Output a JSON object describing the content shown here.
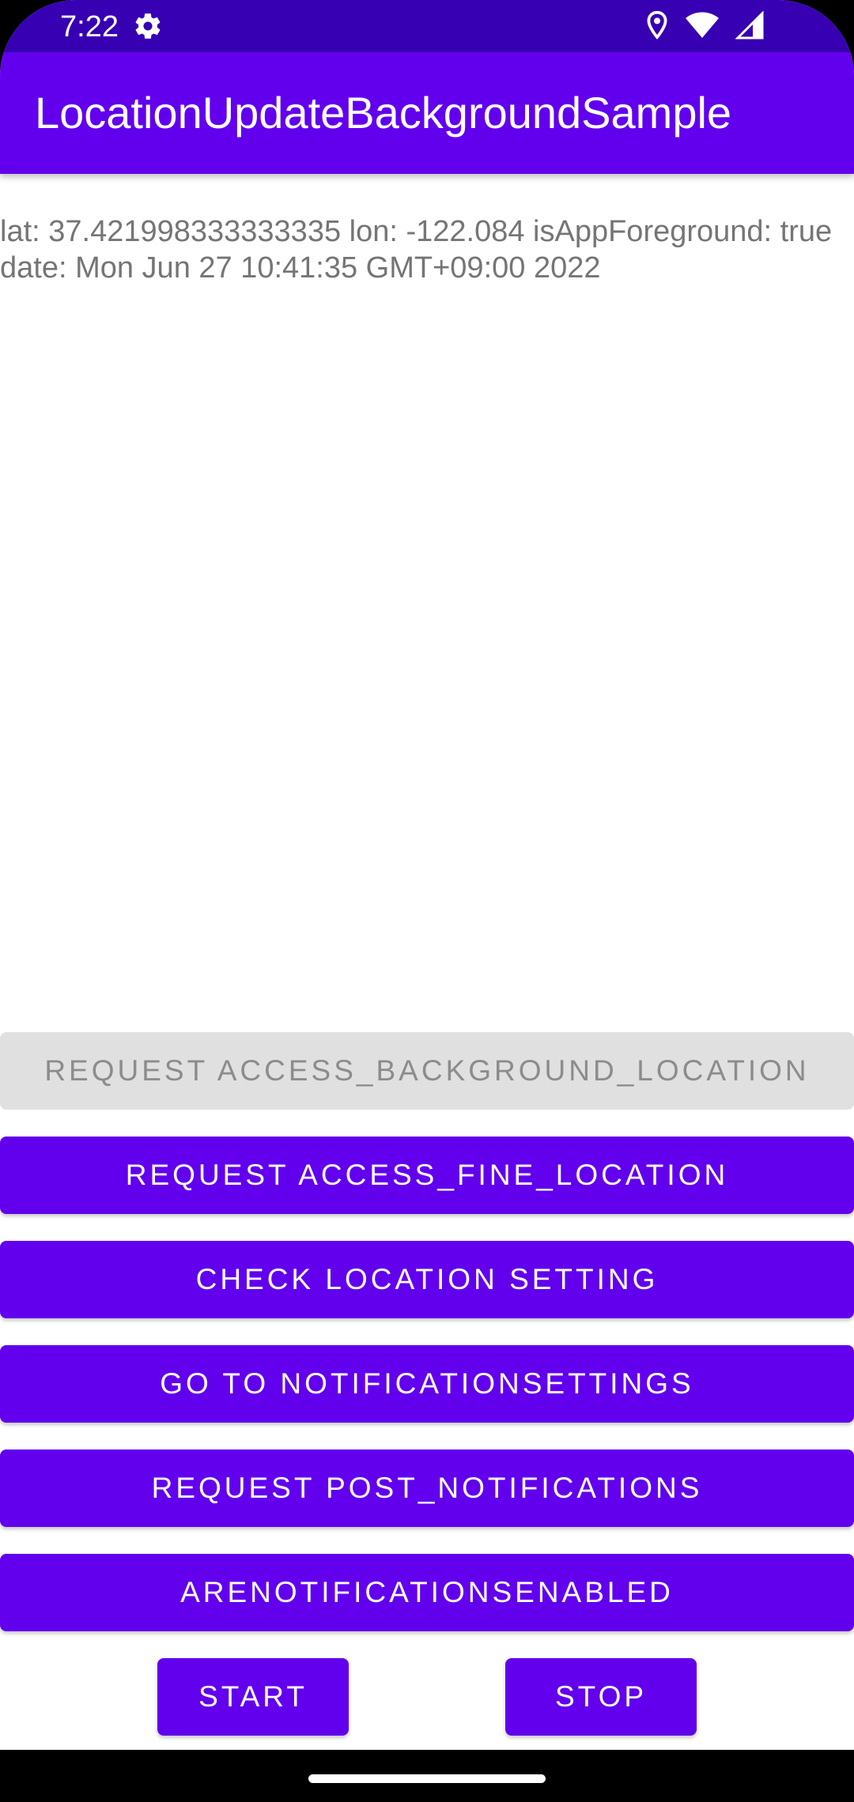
{
  "status_bar": {
    "time": "7:22",
    "icons": [
      "gear-icon",
      "location-pin-icon",
      "wifi-icon",
      "signal-icon"
    ]
  },
  "app_bar": {
    "title": "LocationUpdateBackgroundSample"
  },
  "location_info": {
    "line1": "lat: 37.421998333333335 lon: -122.084 isAppForeground: true",
    "line2": "date: Mon Jun 27 10:41:35 GMT+09:00 2022"
  },
  "buttons": {
    "request_background": "REQUEST ACCESS_BACKGROUND_LOCATION",
    "request_fine": "REQUEST ACCESS_FINE_LOCATION",
    "check_setting": "CHECK LOCATION SETTING",
    "go_notification_settings": "GO TO NOTIFICATIONSETTINGS",
    "request_post_notifications": "REQUEST POST_NOTIFICATIONS",
    "are_notifications_enabled": "ARENOTIFICATIONSENABLED",
    "start": "START",
    "stop": "STOP"
  },
  "colors": {
    "primary": "#6200ee",
    "primary_dark": "#3700b3",
    "disabled_bg": "#e0e0e0",
    "disabled_text": "#8c8c8c",
    "body_text": "#757575"
  }
}
